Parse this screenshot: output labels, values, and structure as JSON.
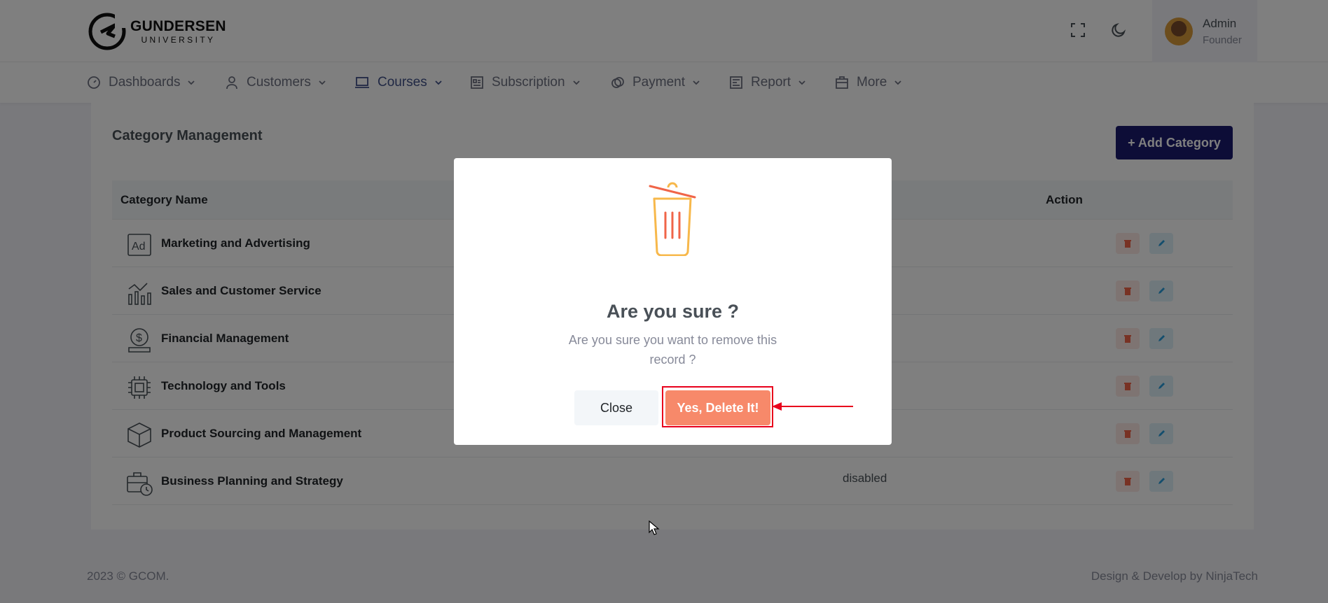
{
  "brand": {
    "name": "GUNDERSEN",
    "sub": "UNIVERSITY"
  },
  "header": {
    "fullscreen_icon": "fullscreen-icon",
    "theme_icon": "moon-icon"
  },
  "user": {
    "name": "Admin",
    "role": "Founder"
  },
  "nav": [
    {
      "label": "Dashboards",
      "icon": "gauge-icon"
    },
    {
      "label": "Customers",
      "icon": "user-icon"
    },
    {
      "label": "Courses",
      "icon": "laptop-icon",
      "active": true
    },
    {
      "label": "Subscription",
      "icon": "newspaper-icon"
    },
    {
      "label": "Payment",
      "icon": "coins-icon"
    },
    {
      "label": "Report",
      "icon": "report-icon"
    },
    {
      "label": "More",
      "icon": "briefcase-icon"
    }
  ],
  "page": {
    "title": "Category Management",
    "add_label": "+ Add Category",
    "columns": {
      "name": "Category Name",
      "action": "Action"
    },
    "rows": [
      {
        "name": "Marketing and Advertising",
        "icon": "ad-icon",
        "status": ""
      },
      {
        "name": "Sales and Customer Service",
        "icon": "chart-icon",
        "status": ""
      },
      {
        "name": "Financial Management",
        "icon": "dollar-icon",
        "status": ""
      },
      {
        "name": "Technology and Tools",
        "icon": "chip-icon",
        "status": ""
      },
      {
        "name": "Product Sourcing and Management",
        "icon": "box-icon",
        "status": ""
      },
      {
        "name": "Business Planning and Strategy",
        "icon": "briefcase-clock-icon",
        "status": "disabled"
      }
    ]
  },
  "modal": {
    "title": "Are you sure ?",
    "text": "Are you sure you want to remove this record ?",
    "close_label": "Close",
    "confirm_label": "Yes, Delete It!"
  },
  "footer": {
    "left": "2023 © GCOM.",
    "right": "Design & Develop by NinjaTech"
  },
  "colors": {
    "primary": "#1a1a6e",
    "danger": "#f7896a",
    "highlight": "#e8001c"
  }
}
